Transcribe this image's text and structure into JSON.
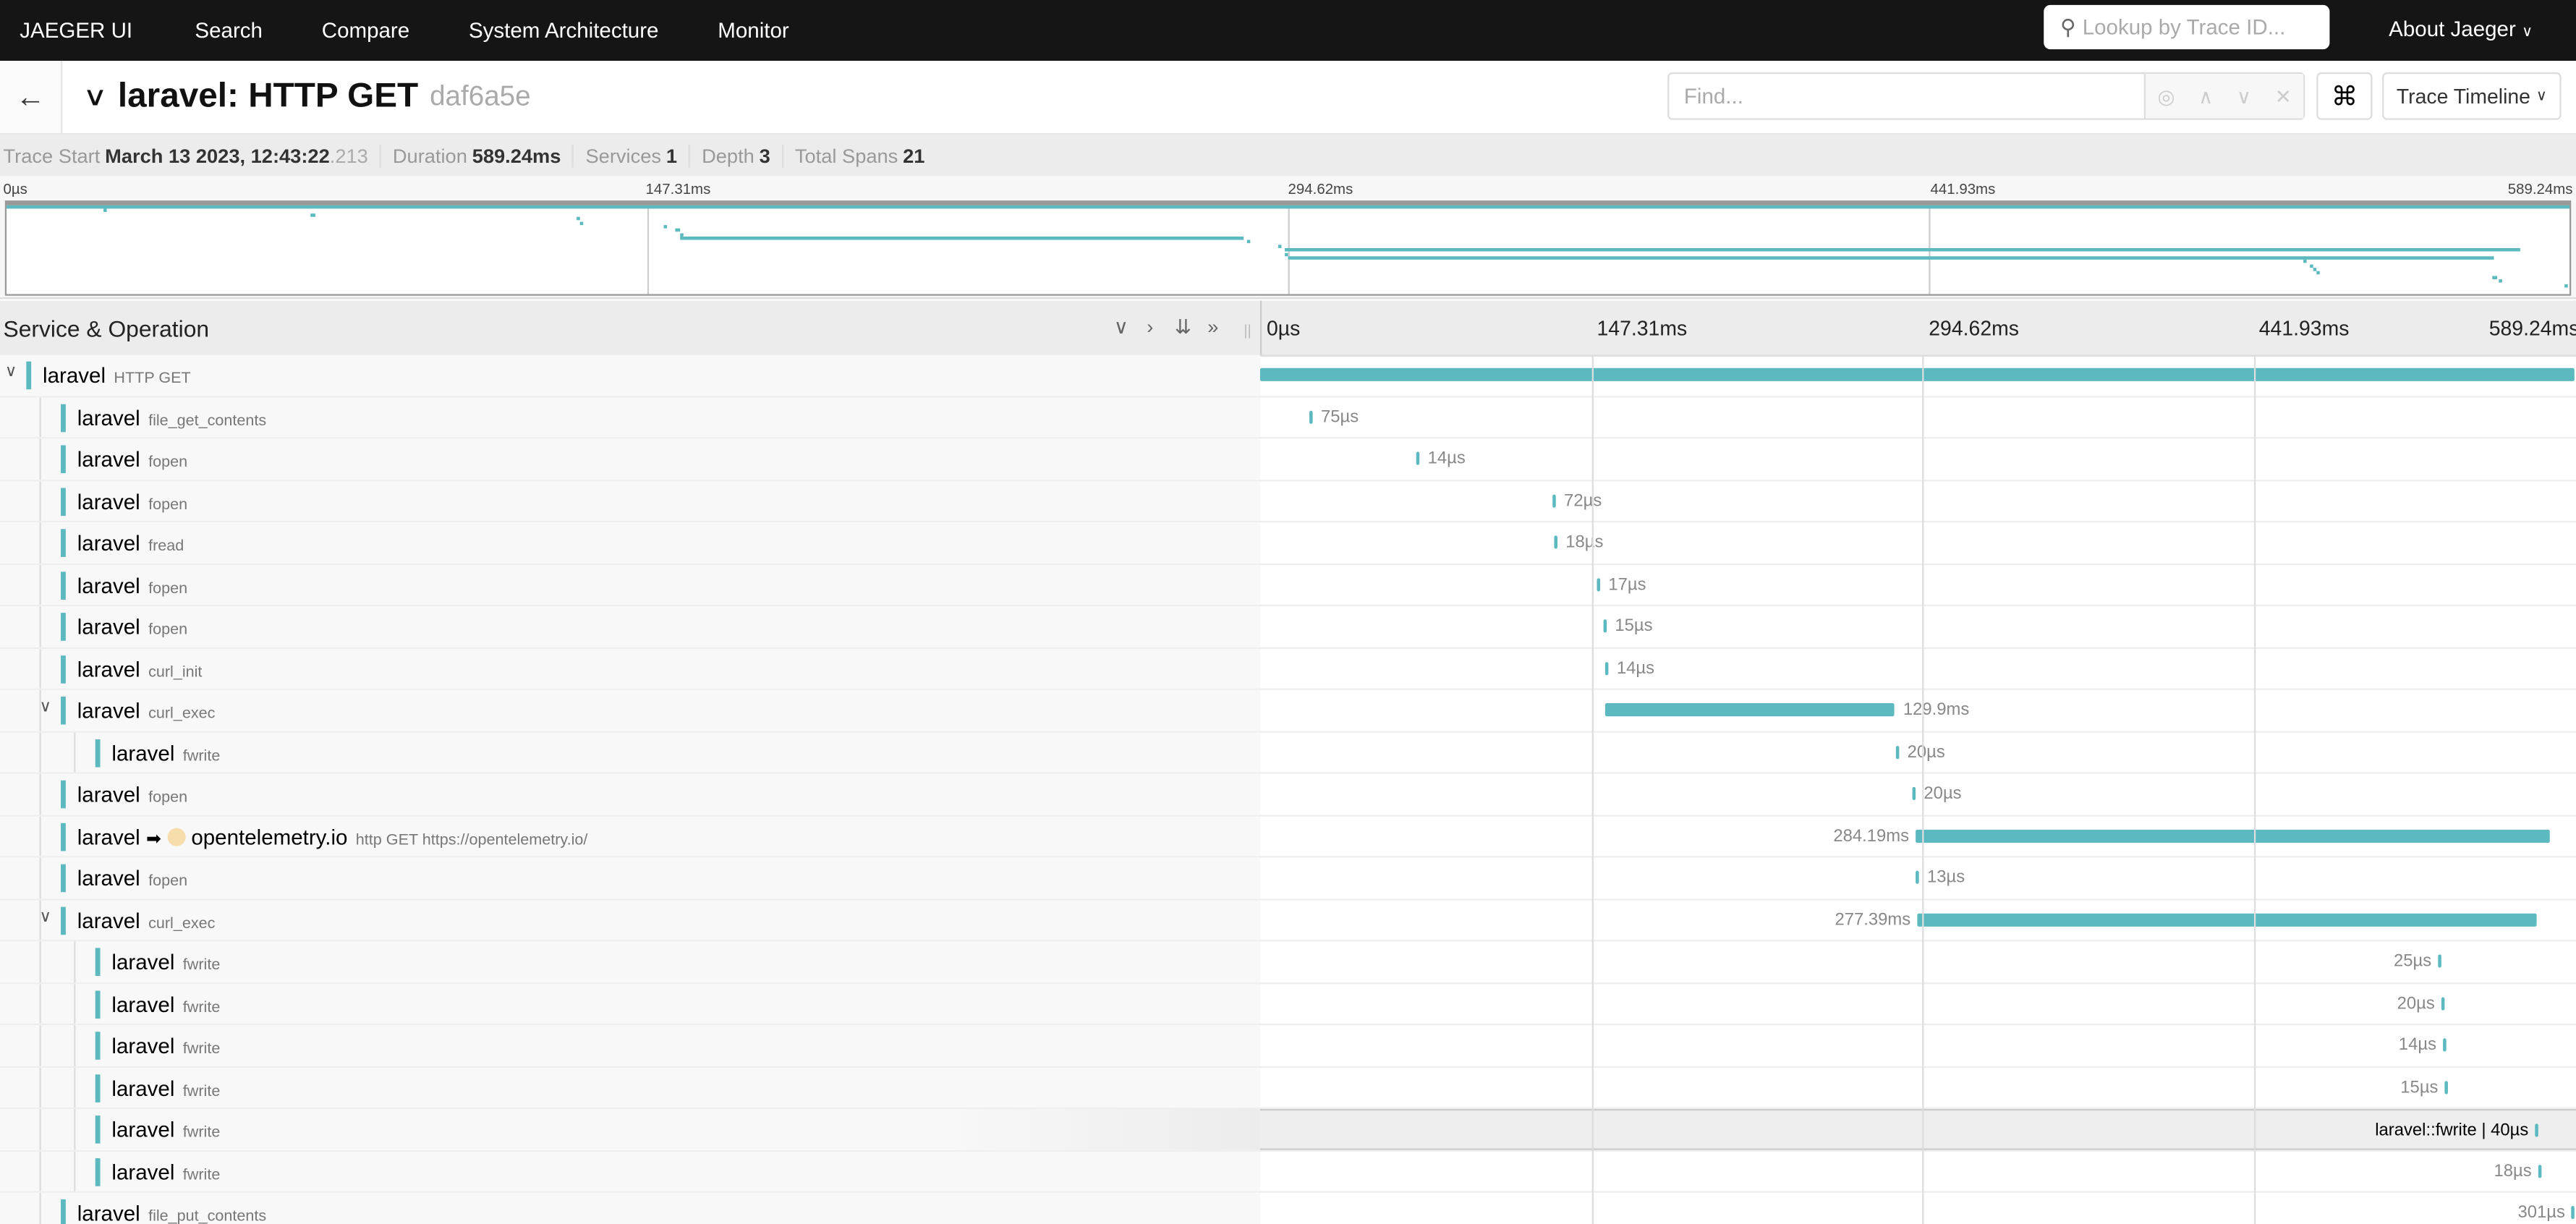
{
  "nav": {
    "brand": "JAEGER UI",
    "items": [
      "Search",
      "Compare",
      "System Architecture",
      "Monitor"
    ],
    "lookup_placeholder": "Lookup by Trace ID...",
    "about": "About Jaeger"
  },
  "header": {
    "service": "laravel:",
    "operation": "HTTP GET",
    "trace_id": "daf6a5e",
    "find_placeholder": "Find...",
    "view_select": "Trace Timeline"
  },
  "meta": {
    "trace_start_label": "Trace Start",
    "trace_start": "March 13 2023, 12:43:22",
    "trace_start_ms": ".213",
    "duration_label": "Duration",
    "duration": "589.24ms",
    "services_label": "Services",
    "services": "1",
    "depth_label": "Depth",
    "depth": "3",
    "total_spans_label": "Total Spans",
    "total_spans": "21"
  },
  "ticks": [
    "0µs",
    "147.31ms",
    "294.62ms",
    "441.93ms",
    "589.24ms"
  ],
  "table_header": "Service & Operation",
  "total_ms": 589.24,
  "accent": "#5cb9bf",
  "hovered_label": "laravel::fwrite | 40µs",
  "spans": [
    {
      "service": "laravel",
      "op": "HTTP GET",
      "depth": 0,
      "collapsible": true,
      "start": 0,
      "dur": 589.24,
      "label": ""
    },
    {
      "service": "laravel",
      "op": "file_get_contents",
      "depth": 1,
      "start": 22.1,
      "dur": 0.075,
      "label": "75µs"
    },
    {
      "service": "laravel",
      "op": "fopen",
      "depth": 1,
      "start": 70.0,
      "dur": 0.014,
      "label": "14µs"
    },
    {
      "service": "laravel",
      "op": "fopen",
      "depth": 1,
      "start": 131.1,
      "dur": 0.072,
      "label": "72µs"
    },
    {
      "service": "laravel",
      "op": "fread",
      "depth": 1,
      "start": 131.8,
      "dur": 0.018,
      "label": "18µs"
    },
    {
      "service": "laravel",
      "op": "fopen",
      "depth": 1,
      "start": 151.0,
      "dur": 0.017,
      "label": "17µs"
    },
    {
      "service": "laravel",
      "op": "fopen",
      "depth": 1,
      "start": 153.9,
      "dur": 0.015,
      "label": "15µs"
    },
    {
      "service": "laravel",
      "op": "curl_init",
      "depth": 1,
      "start": 154.7,
      "dur": 0.014,
      "label": "14µs"
    },
    {
      "service": "laravel",
      "op": "curl_exec",
      "depth": 1,
      "collapsible": true,
      "start": 154.7,
      "dur": 129.9,
      "label": "129.9ms"
    },
    {
      "service": "laravel",
      "op": "fwrite",
      "depth": 2,
      "start": 285.0,
      "dur": 0.02,
      "label": "20µs"
    },
    {
      "service": "laravel",
      "op": "fopen",
      "depth": 1,
      "start": 292.4,
      "dur": 0.02,
      "label": "20µs"
    },
    {
      "service": "laravel",
      "op": "http GET https://opentelemetry.io/",
      "depth": 1,
      "peer": "opentelemetry.io",
      "start": 293.9,
      "dur": 284.19,
      "label": "284.19ms"
    },
    {
      "service": "laravel",
      "op": "fopen",
      "depth": 1,
      "start": 293.9,
      "dur": 0.013,
      "label": "13µs"
    },
    {
      "service": "laravel",
      "op": "curl_exec",
      "depth": 1,
      "collapsible": true,
      "start": 294.6,
      "dur": 277.39,
      "label": "277.39ms"
    },
    {
      "service": "laravel",
      "op": "fwrite",
      "depth": 2,
      "start": 528.1,
      "dur": 0.025,
      "label": "25µs"
    },
    {
      "service": "laravel",
      "op": "fwrite",
      "depth": 2,
      "start": 529.6,
      "dur": 0.02,
      "label": "20µs"
    },
    {
      "service": "laravel",
      "op": "fwrite",
      "depth": 2,
      "start": 530.3,
      "dur": 0.014,
      "label": "14µs"
    },
    {
      "service": "laravel",
      "op": "fwrite",
      "depth": 2,
      "start": 531.1,
      "dur": 0.015,
      "label": "15µs"
    },
    {
      "service": "laravel",
      "op": "fwrite",
      "depth": 2,
      "hovered": true,
      "start": 571.6,
      "dur": 0.04,
      "label": "40µs"
    },
    {
      "service": "laravel",
      "op": "fwrite",
      "depth": 2,
      "start": 573.0,
      "dur": 0.018,
      "label": "18µs"
    },
    {
      "service": "laravel",
      "op": "file_put_contents",
      "depth": 1,
      "start": 588.0,
      "dur": 0.301,
      "label": "301µs"
    }
  ]
}
